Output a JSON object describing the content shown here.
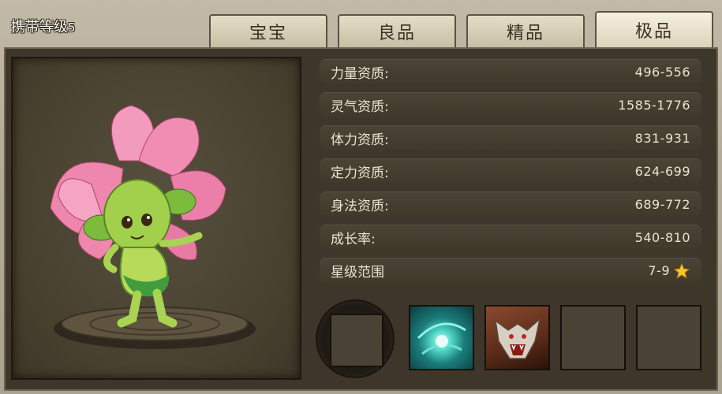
{
  "header": {
    "carry_label": "携带等级",
    "carry_level": "5"
  },
  "tabs": [
    {
      "label": "宝宝",
      "active": false
    },
    {
      "label": "良品",
      "active": false
    },
    {
      "label": "精品",
      "active": false
    },
    {
      "label": "极品",
      "active": true
    }
  ],
  "stats": [
    {
      "label": "力量资质:",
      "value": "496-556"
    },
    {
      "label": "灵气资质:",
      "value": "1585-1776"
    },
    {
      "label": "体力资质:",
      "value": "831-931"
    },
    {
      "label": "定力资质:",
      "value": "624-699"
    },
    {
      "label": "身法资质:",
      "value": "689-772"
    },
    {
      "label": "成长率:",
      "value": "540-810"
    },
    {
      "label": "星级范围",
      "value": "7-9",
      "icon": "star-icon"
    }
  ],
  "skills": [
    {
      "name": "empty-skill-slot-large"
    },
    {
      "name": "spirit-burst-skill-icon"
    },
    {
      "name": "wolf-roar-skill-icon"
    },
    {
      "name": "empty-skill-slot"
    },
    {
      "name": "empty-skill-slot"
    }
  ],
  "colors": {
    "panel_bg": "#b2aa98",
    "content_bg": "#3e362b",
    "stat_text": "#e9e3d1",
    "tab_text": "#3b3125",
    "star": "#f4c430"
  }
}
